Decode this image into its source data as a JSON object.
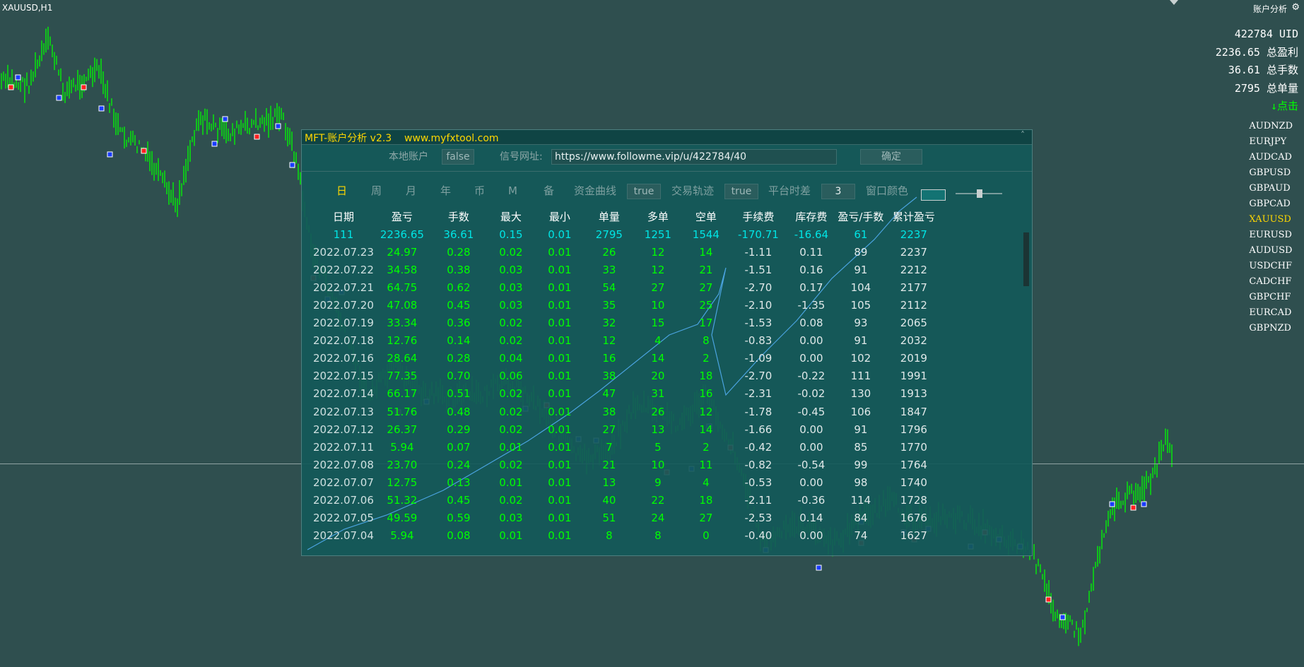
{
  "chart": {
    "symbol_title": "XAUUSD,H1",
    "panel_toggle_label": "账户分析",
    "gear_icon": "gear-icon"
  },
  "account_info": [
    {
      "value": "422784",
      "label": "UID"
    },
    {
      "value": "2236.65",
      "label": "总盈利"
    },
    {
      "value": "36.61",
      "label": "总手数"
    },
    {
      "value": "2795",
      "label": "总单量"
    }
  ],
  "click_hint": "↓点击",
  "symbols": [
    "AUDNZD",
    "EURJPY",
    "AUDCAD",
    "GBPUSD",
    "GBPAUD",
    "GBPCAD",
    "XAUUSD",
    "EURUSD",
    "AUDUSD",
    "USDCHF",
    "CADCHF",
    "GBPCHF",
    "EURCAD",
    "GBPNZD"
  ],
  "active_symbol": "XAUUSD",
  "panel": {
    "title": "MFT-账户分析 v2.3    www.myfxtool.com",
    "close_icon": "˄",
    "local_account_label": "本地账户",
    "local_account_value": "false",
    "signal_url_label": "信号网址:",
    "signal_url_value": "https://www.followme.vip/u/422784/40",
    "confirm_label": "确定",
    "tabs": [
      "日",
      "周",
      "月",
      "年",
      "币",
      "M",
      "备"
    ],
    "active_tab": "日",
    "equity_curve_label": "资金曲线",
    "equity_curve_value": "true",
    "trade_track_label": "交易轨迹",
    "trade_track_value": "true",
    "platform_tz_label": "平台时差",
    "platform_tz_value": "3",
    "window_color_label": "窗口颜色",
    "headers": [
      "日期",
      "盈亏",
      "手数",
      "最大",
      "最小",
      "单量",
      "多单",
      "空单",
      "手续费",
      "库存费",
      "盈亏/手数",
      "累计盈亏"
    ],
    "summary": [
      "111",
      "2236.65",
      "36.61",
      "0.15",
      "0.01",
      "2795",
      "1251",
      "1544",
      "-170.71",
      "-16.64",
      "61",
      "2237"
    ],
    "rows": [
      [
        "2022.07.23",
        "24.97",
        "0.28",
        "0.02",
        "0.01",
        "26",
        "12",
        "14",
        "-1.11",
        "0.11",
        "89",
        "2237"
      ],
      [
        "2022.07.22",
        "34.58",
        "0.38",
        "0.03",
        "0.01",
        "33",
        "12",
        "21",
        "-1.51",
        "0.16",
        "91",
        "2212"
      ],
      [
        "2022.07.21",
        "64.75",
        "0.62",
        "0.03",
        "0.01",
        "54",
        "27",
        "27",
        "-2.70",
        "0.17",
        "104",
        "2177"
      ],
      [
        "2022.07.20",
        "47.08",
        "0.45",
        "0.03",
        "0.01",
        "35",
        "10",
        "25",
        "-2.10",
        "-1.35",
        "105",
        "2112"
      ],
      [
        "2022.07.19",
        "33.34",
        "0.36",
        "0.02",
        "0.01",
        "32",
        "15",
        "17",
        "-1.53",
        "0.08",
        "93",
        "2065"
      ],
      [
        "2022.07.18",
        "12.76",
        "0.14",
        "0.02",
        "0.01",
        "12",
        "4",
        "8",
        "-0.83",
        "0.00",
        "91",
        "2032"
      ],
      [
        "2022.07.16",
        "28.64",
        "0.28",
        "0.04",
        "0.01",
        "16",
        "14",
        "2",
        "-1.09",
        "0.00",
        "102",
        "2019"
      ],
      [
        "2022.07.15",
        "77.35",
        "0.70",
        "0.06",
        "0.01",
        "38",
        "20",
        "18",
        "-2.70",
        "-0.22",
        "111",
        "1991"
      ],
      [
        "2022.07.14",
        "66.17",
        "0.51",
        "0.02",
        "0.01",
        "47",
        "31",
        "16",
        "-2.31",
        "-0.02",
        "130",
        "1913"
      ],
      [
        "2022.07.13",
        "51.76",
        "0.48",
        "0.02",
        "0.01",
        "38",
        "26",
        "12",
        "-1.78",
        "-0.45",
        "106",
        "1847"
      ],
      [
        "2022.07.12",
        "26.37",
        "0.29",
        "0.02",
        "0.01",
        "27",
        "13",
        "14",
        "-1.66",
        "0.00",
        "91",
        "1796"
      ],
      [
        "2022.07.11",
        "5.94",
        "0.07",
        "0.01",
        "0.01",
        "7",
        "5",
        "2",
        "-0.42",
        "0.00",
        "85",
        "1770"
      ],
      [
        "2022.07.08",
        "23.70",
        "0.24",
        "0.02",
        "0.01",
        "21",
        "10",
        "11",
        "-0.82",
        "-0.54",
        "99",
        "1764"
      ],
      [
        "2022.07.07",
        "12.75",
        "0.13",
        "0.01",
        "0.01",
        "13",
        "9",
        "4",
        "-0.53",
        "0.00",
        "98",
        "1740"
      ],
      [
        "2022.07.06",
        "51.32",
        "0.45",
        "0.02",
        "0.01",
        "40",
        "22",
        "18",
        "-2.11",
        "-0.36",
        "114",
        "1728"
      ],
      [
        "2022.07.05",
        "49.59",
        "0.59",
        "0.03",
        "0.01",
        "51",
        "24",
        "27",
        "-2.53",
        "0.14",
        "84",
        "1676"
      ],
      [
        "2022.07.04",
        "5.94",
        "0.08",
        "0.01",
        "0.01",
        "8",
        "8",
        "0",
        "-0.40",
        "0.00",
        "74",
        "1627"
      ]
    ]
  },
  "colors": {
    "background": "#2f4f4f",
    "candle": "#00ff00",
    "equity_line": "#4aa3df",
    "accent": "#ffd700"
  }
}
